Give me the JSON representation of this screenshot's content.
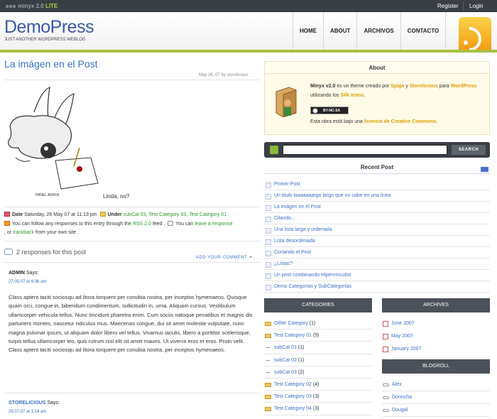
{
  "topbar": {
    "brand": "minyx 2.0",
    "brand_lite": "LITE",
    "register": "Register",
    "login": "Login"
  },
  "header": {
    "title": "DemoPress",
    "description": "JUST ANOTHER WORDPRESS WEBLOG"
  },
  "nav": [
    "HOME",
    "ABOUT",
    "ARCHIVOS",
    "CONTACTO"
  ],
  "post": {
    "title": "La imágen en el Post",
    "date_meta": "May 26, 07 by storelicious",
    "caption": "Linda, no?",
    "info_date_label": "Date",
    "info_date": "Saturday, 26 May 07 at 11:13 pm",
    "info_under_label": "Under",
    "categories": [
      "subCat 03",
      "Test Category 03",
      "Test Category 01"
    ],
    "follow_pre": "You can follow any responses to this entry through the",
    "follow_link": "RSS 2.0",
    "follow_post": "feed .",
    "leave_pre": "You can",
    "leave_link": "leave a response",
    "trackback_pre": ", or",
    "trackback_link": "trackback",
    "trackback_post": "from your own site ."
  },
  "responses": {
    "count_text": "2 responses for this post",
    "add_comment": "ADD YOUR COMMENT"
  },
  "comments": [
    {
      "author": "ADMIN",
      "says": "Says:",
      "date": "27.05.07 at 6:36 am",
      "text": "Class aptent taciti sociosqu ad litora torquent per conubia nostra, per inceptos hymenaeos. Quisque quam orci, congue in, bibendum condimentum, sollicitudin in, urna. Aliquam cursus. Vestibulum ullamcorper vehicula tellus. Nunc tincidunt pharetra enim. Cum sociis natoque penatibus et magnis dis parturient montes, nascetur ridiculus mus. Maecenas congue, dui sit amet molestie vulputate, nunc magna pulvinar ipsum, ut aliquam dolor libero vel tellus. Vivamus iaculis, libero a porttitor scelerisque, turpis tellus ullamcorper leo, quis rutrum nisl elit sit amet mauris. Ut viverra eros et eros. Proin velit. Class aptent taciti sociosqu ad litora torquent per conubia nostra, per inceptos hymenaeos."
    },
    {
      "author": "STORELICIOUS",
      "says": "Says:",
      "date": "29.07.07 at 1:14 am"
    }
  ],
  "about": {
    "heading": "About",
    "t1": "Minyx v2.0",
    "t2": "es un theme creado por",
    "l1": "Spiga",
    "t3": "y",
    "l2": "Storelicious",
    "t4": "para",
    "l3": "WordPress",
    "t5": "utilizando los",
    "l4": "Silk Icons",
    "t6": ".",
    "cc_badge": "BY-NC-SA",
    "lic_pre": "Esta obra está bajo una",
    "lic_link": "licencia de Creative Commons",
    "lic_post": "."
  },
  "search": {
    "button": "SEARCH",
    "placeholder": ""
  },
  "recent": {
    "title": "Recent Post",
    "items": [
      "Primer Post",
      "Un titulo laaaaaaargo largo que no cabe en una linea",
      "La imágen en el Post",
      "Citando...",
      "Una lista larga y ordenada",
      "Lista desordenada",
      "Cortando el Post",
      "¿Listas?",
      "Un post combinando Hipervínculos",
      "Demo Categorías y SubCategorías"
    ]
  },
  "categories": {
    "title": "CATEGORIES",
    "items": [
      {
        "name": "Other Category",
        "count": "(1)",
        "sub": false
      },
      {
        "name": "Test Category 01",
        "count": "(5)",
        "sub": false
      },
      {
        "name": "subCat 01",
        "count": "(1)",
        "sub": true
      },
      {
        "name": "subCat 02",
        "count": "(1)",
        "sub": true
      },
      {
        "name": "subCat 03",
        "count": "(2)",
        "sub": true
      },
      {
        "name": "Test Category 02",
        "count": "(4)",
        "sub": false
      },
      {
        "name": "Test Category 03",
        "count": "(3)",
        "sub": false
      },
      {
        "name": "Test Category 04",
        "count": "(3)",
        "sub": false
      }
    ]
  },
  "archives": {
    "title": "ARCHIVES",
    "items": [
      "June 2007",
      "May 2007",
      "January 2007"
    ]
  },
  "blogroll": {
    "title": "BLOGROLL",
    "items": [
      "Alex",
      "Donncha",
      "Dougal"
    ]
  }
}
